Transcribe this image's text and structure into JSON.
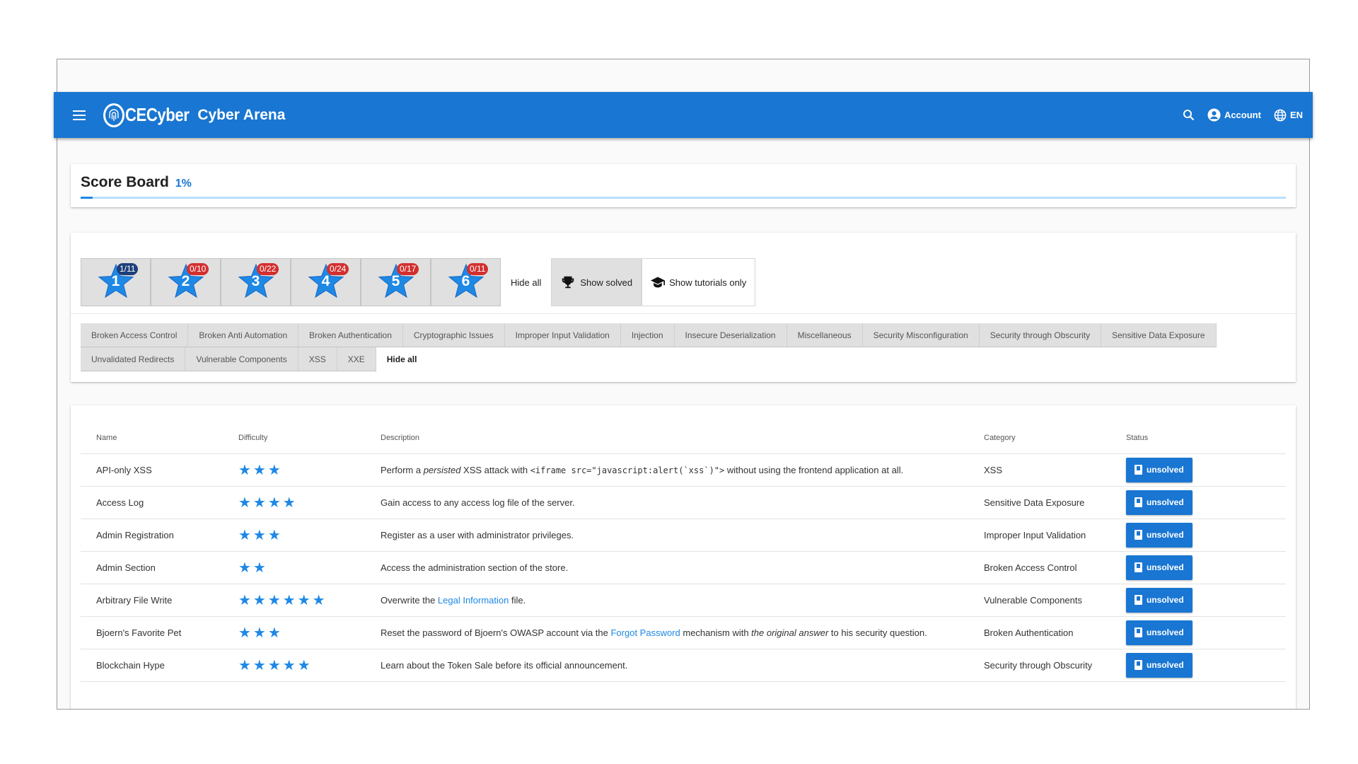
{
  "header": {
    "logo_text": "CECyber",
    "title": "Cyber Arena",
    "account_label": "Account",
    "language_label": "EN"
  },
  "scoreboard": {
    "title": "Score Board",
    "percent": "1%",
    "progress_fraction": 0.01
  },
  "difficulty_filters": [
    {
      "level": "1",
      "badge": "1/11",
      "solved_any": true
    },
    {
      "level": "2",
      "badge": "0/10",
      "solved_any": false
    },
    {
      "level": "3",
      "badge": "0/22",
      "solved_any": false
    },
    {
      "level": "4",
      "badge": "0/24",
      "solved_any": false
    },
    {
      "level": "5",
      "badge": "0/17",
      "solved_any": false
    },
    {
      "level": "6",
      "badge": "0/11",
      "solved_any": false
    }
  ],
  "filter_actions": {
    "hide_all": "Hide all",
    "show_solved": "Show solved",
    "show_tutorials": "Show tutorials only"
  },
  "categories": [
    "Broken Access Control",
    "Broken Anti Automation",
    "Broken Authentication",
    "Cryptographic Issues",
    "Improper Input Validation",
    "Injection",
    "Insecure Deserialization",
    "Miscellaneous",
    "Security Misconfiguration",
    "Security through Obscurity",
    "Sensitive Data Exposure",
    "Unvalidated Redirects",
    "Vulnerable Components",
    "XSS",
    "XXE"
  ],
  "categories_hide_all": "Hide all",
  "table": {
    "headers": {
      "name": "Name",
      "difficulty": "Difficulty",
      "description": "Description",
      "category": "Category",
      "status": "Status"
    },
    "rows": [
      {
        "name": "API-only XSS",
        "stars": 3,
        "category": "XSS",
        "status": "unsolved",
        "desc": [
          {
            "t": "Perform a "
          },
          {
            "t": "persisted",
            "i": true
          },
          {
            "t": " XSS attack with "
          },
          {
            "t": "<iframe src=\"javascript:alert(`xss`)\">",
            "c": true
          },
          {
            "t": " without using the frontend application at all."
          }
        ]
      },
      {
        "name": "Access Log",
        "stars": 4,
        "category": "Sensitive Data Exposure",
        "status": "unsolved",
        "desc": [
          {
            "t": "Gain access to any access log file of the server."
          }
        ]
      },
      {
        "name": "Admin Registration",
        "stars": 3,
        "category": "Improper Input Validation",
        "status": "unsolved",
        "desc": [
          {
            "t": "Register as a user with administrator privileges."
          }
        ]
      },
      {
        "name": "Admin Section",
        "stars": 2,
        "category": "Broken Access Control",
        "status": "unsolved",
        "desc": [
          {
            "t": "Access the administration section of the store."
          }
        ]
      },
      {
        "name": "Arbitrary File Write",
        "stars": 6,
        "category": "Vulnerable Components",
        "status": "unsolved",
        "desc": [
          {
            "t": "Overwrite the "
          },
          {
            "t": "Legal Information",
            "l": true
          },
          {
            "t": " file."
          }
        ]
      },
      {
        "name": "Bjoern's Favorite Pet",
        "stars": 3,
        "category": "Broken Authentication",
        "status": "unsolved",
        "desc": [
          {
            "t": "Reset the password of Bjoern's OWASP account via the "
          },
          {
            "t": "Forgot Password",
            "l": true
          },
          {
            "t": " mechanism with "
          },
          {
            "t": "the original answer",
            "i": true
          },
          {
            "t": " to his security question."
          }
        ]
      },
      {
        "name": "Blockchain Hype",
        "stars": 5,
        "category": "Security through Obscurity",
        "status": "unsolved",
        "desc": [
          {
            "t": "Learn about the Token Sale before its official announcement."
          }
        ]
      }
    ]
  },
  "colors": {
    "primary": "#1976d2",
    "star": "#1e88e5",
    "badge_red": "#d32f2f",
    "badge_dark": "#1e3f7a"
  }
}
